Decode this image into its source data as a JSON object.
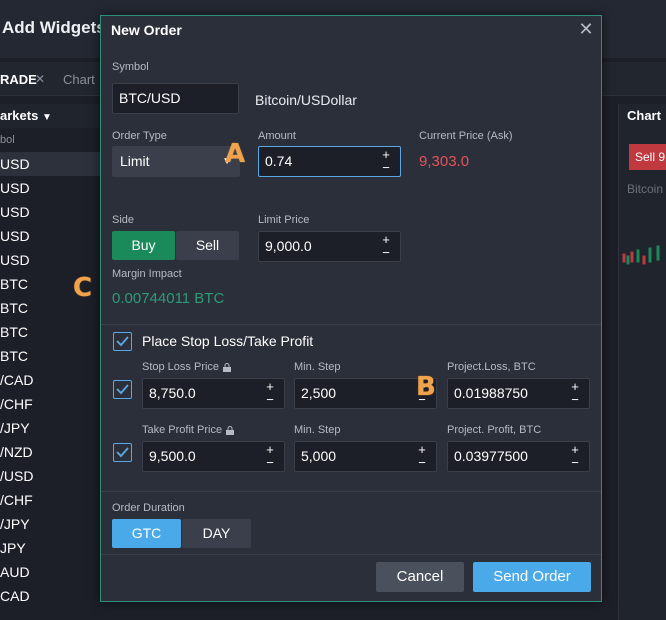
{
  "background": {
    "title": "Add Widgets",
    "tabs": [
      "RADE",
      "Chart"
    ],
    "tab_close": "✕",
    "markets_title": "arkets",
    "markets_arrow": "▼",
    "sym_header": "bol",
    "rows": [
      "USD",
      "USD",
      "USD",
      "USD",
      "USD",
      "BTC",
      "BTC",
      "BTC",
      "BTC",
      "/CAD",
      "/CHF",
      "/JPY",
      "/NZD",
      "/USD",
      "/CHF",
      "/JPY",
      "JPY",
      "AUD",
      "CAD"
    ],
    "trade_label": "Trade",
    "chart_title": "Chart",
    "chart_sell": "Sell 9",
    "chart_pair": "Bitcoin"
  },
  "dialog": {
    "title": "New Order",
    "close_icon": "✕",
    "symbol_label": "Symbol",
    "symbol_value": "BTC/USD",
    "symbol_name": "Bitcoin/USDollar",
    "order_type_label": "Order Type",
    "order_type_value": "Limit",
    "amount_label": "Amount",
    "amount_value": "0.74",
    "current_price_label": "Current Price (Ask)",
    "current_price_value": "9,303.0",
    "side_label": "Side",
    "buy_label": "Buy",
    "sell_label": "Sell",
    "limit_price_label": "Limit Price",
    "limit_price_value": "9,000.0",
    "margin_label": "Margin Impact",
    "margin_value": "0.00744011 BTC",
    "stop_take_label": "Place Stop Loss/Take Profit",
    "stop_loss_label": "Stop Loss Price",
    "stop_loss_value": "8,750.0",
    "sl_min_step_label": "Min. Step",
    "sl_min_step_value": "2,500",
    "project_loss_label": "Project.Loss, BTC",
    "project_loss_value": "0.01988750",
    "take_profit_label": "Take Profit Price",
    "take_profit_value": "9,500.0",
    "tp_min_step_label": "Min. Step",
    "tp_min_step_value": "5,000",
    "project_profit_label": "Project. Profit, BTC",
    "project_profit_value": "0.03977500",
    "duration_label": "Order Duration",
    "gtc_label": "GTC",
    "day_label": "DAY",
    "cancel_label": "Cancel",
    "send_label": "Send Order",
    "plus": "+",
    "minus": "−"
  },
  "markers": {
    "a": "A",
    "b": "B",
    "c": "C"
  },
  "colors": {
    "accent": "#4aa9e9",
    "buy": "#1a8a5a",
    "ask_price": "#e4535b",
    "margin": "#2f9a78",
    "marker": "#f0a34a"
  },
  "icons": {
    "lock": "lock-icon",
    "check": "check-icon",
    "close": "close-icon",
    "caret": "caret-down-icon"
  }
}
